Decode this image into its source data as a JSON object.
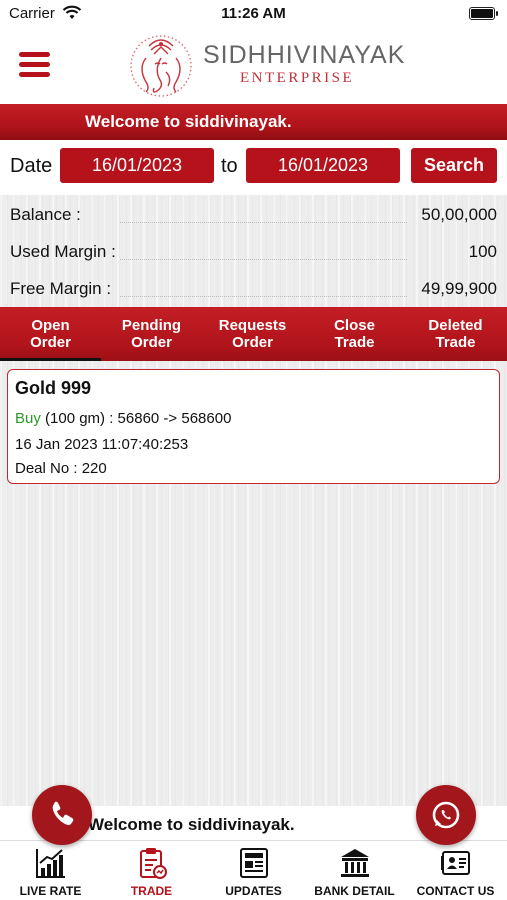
{
  "status_bar": {
    "carrier": "Carrier",
    "time": "11:26 AM"
  },
  "brand": {
    "name": "SIDHHIVINAYAK",
    "subtitle": "ENTERPRISE"
  },
  "welcome_text": "Welcome to siddivinayak.",
  "date_filter": {
    "date_label": "Date",
    "from": "16/01/2023",
    "to_label": "to",
    "to": "16/01/2023",
    "search_label": "Search"
  },
  "balance": {
    "rows": [
      {
        "label": "Balance :",
        "value": "50,00,000"
      },
      {
        "label": "Used Margin :",
        "value": "100"
      },
      {
        "label": "Free Margin :",
        "value": "49,99,900"
      }
    ]
  },
  "tabs": [
    {
      "line1": "Open",
      "line2": "Order",
      "active": true
    },
    {
      "line1": "Pending",
      "line2": "Order",
      "active": false
    },
    {
      "line1": "Requests",
      "line2": "Order",
      "active": false
    },
    {
      "line1": "Close",
      "line2": "Trade",
      "active": false
    },
    {
      "line1": "Deleted",
      "line2": "Trade",
      "active": false
    }
  ],
  "orders": [
    {
      "title": "Gold 999",
      "side": "Buy",
      "detail": " (100 gm) : 56860 -> 568600",
      "datetime": "16 Jan 2023 11:07:40:253",
      "deal": "Deal No : 220"
    }
  ],
  "bottom_nav": [
    {
      "label": "LIVE RATE",
      "icon": "chart-icon",
      "active": false
    },
    {
      "label": "TRADE",
      "icon": "clipboard-icon",
      "active": true
    },
    {
      "label": "UPDATES",
      "icon": "newspaper-icon",
      "active": false
    },
    {
      "label": "BANK DETAIL",
      "icon": "bank-icon",
      "active": false
    },
    {
      "label": "CONTACT US",
      "icon": "contact-card-icon",
      "active": false
    }
  ],
  "colors": {
    "primary": "#b5121b",
    "buy": "#2a9b2a"
  }
}
